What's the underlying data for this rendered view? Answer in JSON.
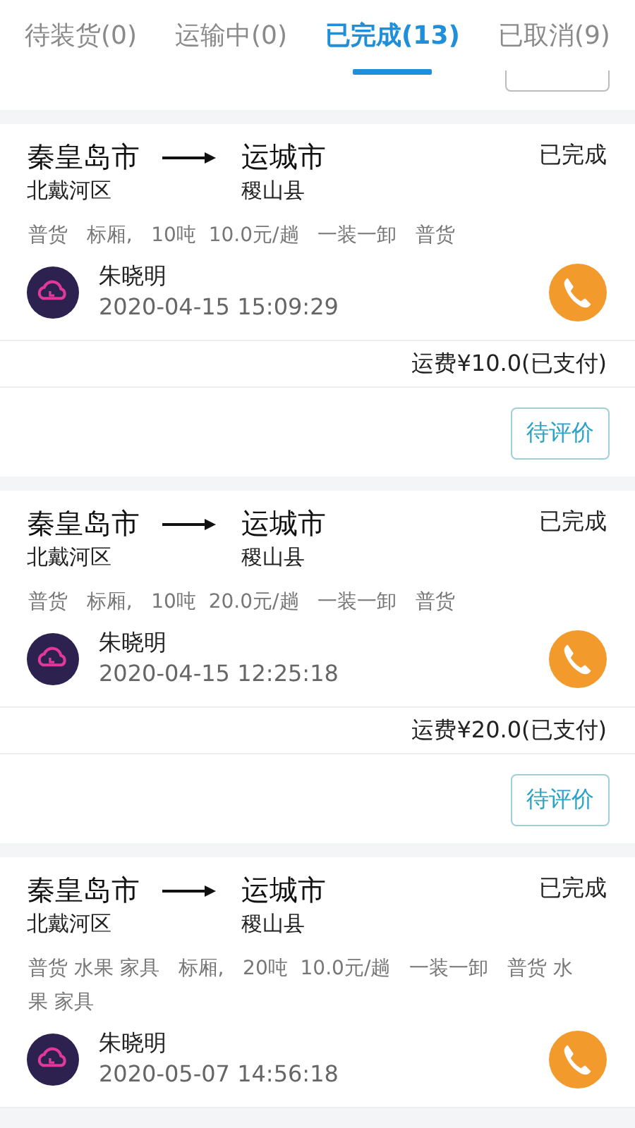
{
  "tabs": [
    {
      "label": "待装货(0)",
      "selected": false
    },
    {
      "label": "运输中(0)",
      "selected": false
    },
    {
      "label": "已完成(13)",
      "selected": true
    },
    {
      "label": "已取消(9)",
      "selected": false
    }
  ],
  "orders": [
    {
      "from_city": "秦皇岛市",
      "from_district": "北戴河区",
      "to_city": "运城市",
      "to_district": "稷山县",
      "status": "已完成",
      "specs": "普货   标厢,   10吨  10.0元/趟   一装一卸   普货",
      "driver": "朱晓明",
      "time": "2020-04-15 15:09:29",
      "fee": "运费¥10.0(已支付)",
      "action": "待评价"
    },
    {
      "from_city": "秦皇岛市",
      "from_district": "北戴河区",
      "to_city": "运城市",
      "to_district": "稷山县",
      "status": "已完成",
      "specs": "普货   标厢,   10吨  20.0元/趟   一装一卸   普货",
      "driver": "朱晓明",
      "time": "2020-04-15 12:25:18",
      "fee": "运费¥20.0(已支付)",
      "action": "待评价"
    },
    {
      "from_city": "秦皇岛市",
      "from_district": "北戴河区",
      "to_city": "运城市",
      "to_district": "稷山县",
      "status": "已完成",
      "specs": "普货 水果 家具   标厢,   20吨  10.0元/趟   一装一卸   普货 水果 家具",
      "driver": "朱晓明",
      "time": "2020-05-07 14:56:18"
    }
  ]
}
